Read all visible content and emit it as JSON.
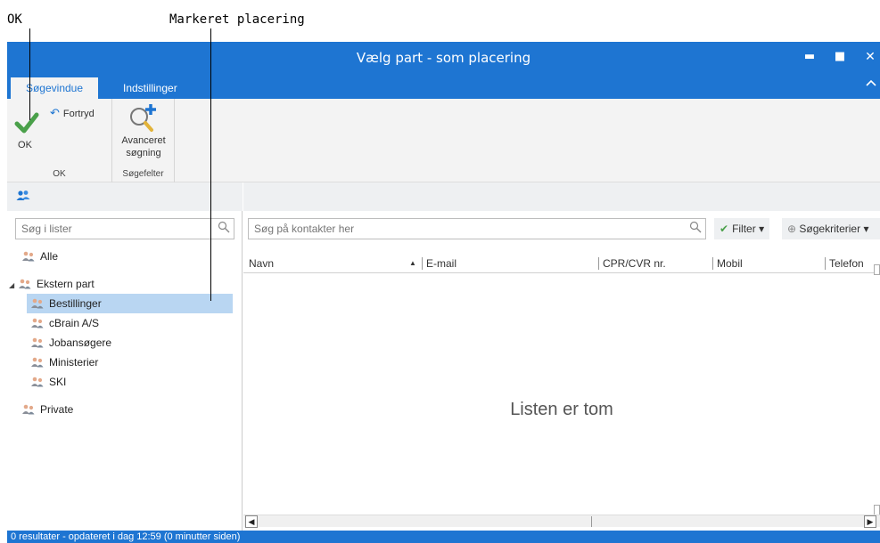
{
  "callouts": {
    "ok": "OK",
    "marked": "Markeret placering"
  },
  "window": {
    "title": "Vælg part - som placering",
    "controls": {
      "minimize": "▬",
      "maximize": "■",
      "close": "✕"
    }
  },
  "tabs": [
    {
      "label": "Søgevindue",
      "active": true
    },
    {
      "label": "Indstillinger",
      "active": false
    }
  ],
  "ribbon": {
    "ok_label": "OK",
    "undo_label": "Fortryd",
    "ok_group_label": "OK",
    "advanced_label_1": "Avanceret",
    "advanced_label_2": "søgning",
    "search_group_label": "Søgefelter"
  },
  "left": {
    "search_placeholder": "Søg i lister",
    "items": [
      {
        "label": "Alle",
        "level": 0,
        "expander": ""
      },
      {
        "label": "Ekstern part",
        "level": 0,
        "expander": "◢"
      },
      {
        "label": "Bestillinger",
        "level": 1,
        "selected": true
      },
      {
        "label": "cBrain A/S",
        "level": 1
      },
      {
        "label": "Jobansøgere",
        "level": 1
      },
      {
        "label": "Ministerier",
        "level": 1
      },
      {
        "label": "SKI",
        "level": 1
      },
      {
        "label": "Private",
        "level": 0
      }
    ]
  },
  "right": {
    "search_placeholder": "Søg på kontakter her",
    "filter_label": "Filter",
    "criteria_label": "Søgekriterier",
    "columns": [
      "Navn",
      "E-mail",
      "CPR/CVR nr.",
      "Mobil",
      "Telefon"
    ],
    "empty_message": "Listen er tom"
  },
  "status": {
    "text": "0 resultater - opdateret i dag 12:59 (0 minutter siden)"
  },
  "colors": {
    "accent": "#1e75d2",
    "selected": "#b9d6f2",
    "check": "#4aa04a"
  }
}
